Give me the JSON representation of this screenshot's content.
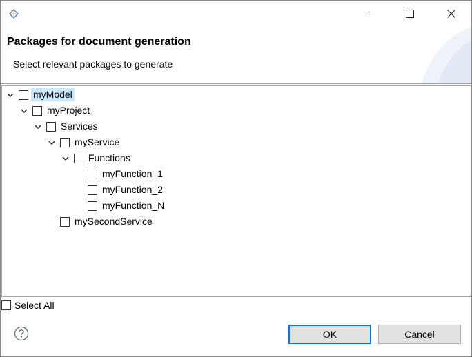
{
  "window": {
    "app_icon": "eclipse-dialog-icon",
    "controls": [
      "minimize-icon",
      "maximize-icon",
      "close-icon"
    ]
  },
  "header": {
    "title": "Packages for document generation",
    "subtitle": "Select relevant packages to generate"
  },
  "tree": {
    "items": [
      {
        "label": "myModel",
        "level": 0,
        "expanded": true,
        "checked": false,
        "selected": true
      },
      {
        "label": "myProject",
        "level": 1,
        "expanded": true,
        "checked": false
      },
      {
        "label": "Services",
        "level": 2,
        "expanded": true,
        "checked": false
      },
      {
        "label": "myService",
        "level": 3,
        "expanded": true,
        "checked": false
      },
      {
        "label": "Functions",
        "level": 4,
        "expanded": true,
        "checked": false
      },
      {
        "label": "myFunction_1",
        "level": 5,
        "expanded": null,
        "checked": false
      },
      {
        "label": "myFunction_2",
        "level": 5,
        "expanded": null,
        "checked": false
      },
      {
        "label": "myFunction_N",
        "level": 5,
        "expanded": null,
        "checked": false
      },
      {
        "label": "mySecondService",
        "level": 3,
        "expanded": null,
        "checked": false
      }
    ]
  },
  "select_all": {
    "label": "Select All",
    "checked": false
  },
  "help_icon": "help-icon",
  "buttons": {
    "ok": "OK",
    "cancel": "Cancel"
  },
  "colors": {
    "selection": "#cce8ff",
    "default_button_border": "#0078d7",
    "button_bg": "#e1e1e1"
  }
}
